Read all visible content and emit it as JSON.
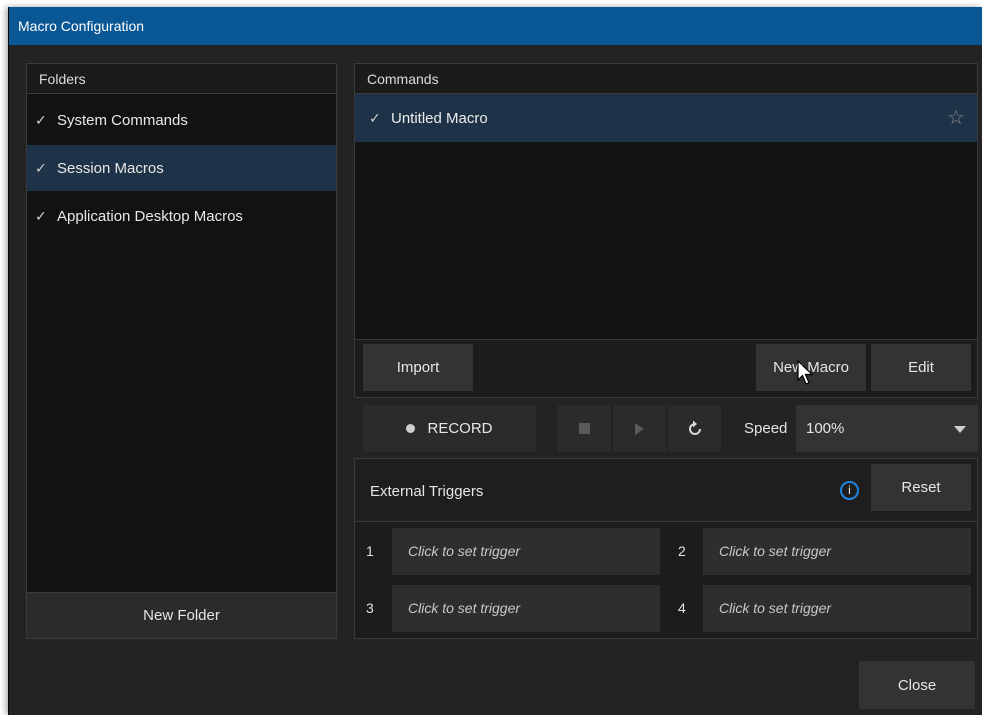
{
  "window": {
    "title": "Macro Configuration"
  },
  "folders": {
    "header": "Folders",
    "items": [
      {
        "check": "✓",
        "label": "System Commands",
        "selected": false
      },
      {
        "check": "✓",
        "label": "Session Macros",
        "selected": true
      },
      {
        "check": "✓",
        "label": "Application Desktop Macros",
        "selected": false
      }
    ],
    "new_folder_label": "New Folder"
  },
  "commands": {
    "header": "Commands",
    "items": [
      {
        "check": "✓",
        "label": "Untitled Macro",
        "favorite_icon": "star-outline-icon"
      }
    ],
    "import_label": "Import",
    "new_macro_label": "New Macro",
    "edit_label": "Edit"
  },
  "transport": {
    "record_label": "RECORD",
    "stop_icon": "stop-icon",
    "play_icon": "play-icon",
    "loop_icon": "loop-icon",
    "speed_label": "Speed",
    "speed_value": "100%"
  },
  "external_triggers": {
    "header": "External Triggers",
    "info_glyph": "i",
    "reset_label": "Reset",
    "triggers": [
      {
        "number": "1",
        "label": "Click to set trigger"
      },
      {
        "number": "2",
        "label": "Click to set trigger"
      },
      {
        "number": "3",
        "label": "Click to set trigger"
      },
      {
        "number": "4",
        "label": "Click to set trigger"
      }
    ]
  },
  "close_label": "Close",
  "colors": {
    "titlebar": "#0a5796",
    "selection": "#1e3347",
    "info_accent": "#1f86e0"
  }
}
